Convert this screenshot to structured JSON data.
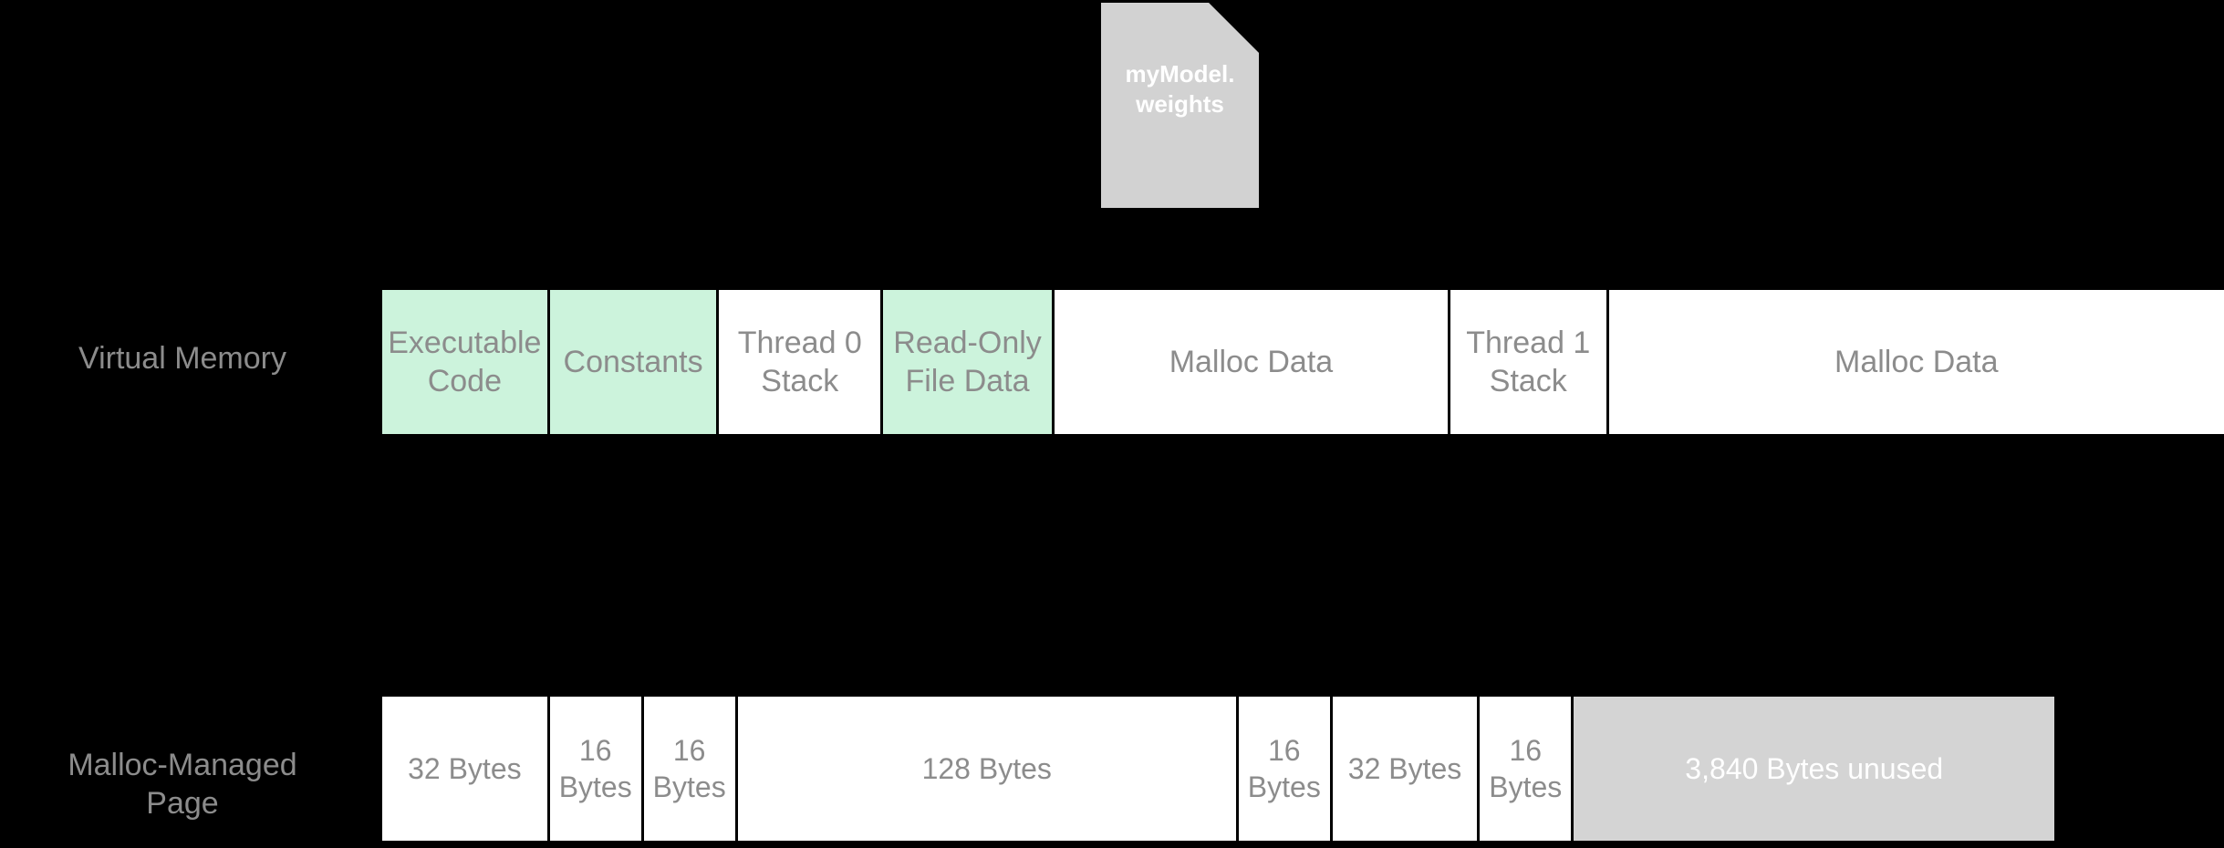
{
  "background_color": "#000000",
  "colors": {
    "text_gray": "#8c8c8c",
    "segment_white": "#ffffff",
    "segment_green": "#ccf3dc",
    "segment_gray": "#d4d4d4",
    "file_icon_gray": "#d2d2d2",
    "file_label_white": "#ffffff",
    "divider_black": "#000000"
  },
  "file_icon": {
    "icon_name": "document-file-icon",
    "label_line_1": "myModel.",
    "label_line_2": "weights"
  },
  "rows": [
    {
      "id": "virtual-memory",
      "label": "Virtual Memory",
      "segments": [
        {
          "name": "executable-code",
          "lines": [
            "Executable",
            "Code"
          ],
          "style": "green",
          "width_pct": 9.1
        },
        {
          "name": "constants",
          "lines": [
            "Constants"
          ],
          "style": "green",
          "width_pct": 9.2
        },
        {
          "name": "thread-0-stack",
          "lines": [
            "Thread 0",
            "Stack"
          ],
          "style": "white",
          "width_pct": 8.9
        },
        {
          "name": "read-only-file-data",
          "lines": [
            "Read-Only",
            "File Data"
          ],
          "style": "green",
          "width_pct": 9.3
        },
        {
          "name": "malloc-data-1",
          "lines": [
            "Malloc Data"
          ],
          "style": "white",
          "width_pct": 21.5
        },
        {
          "name": "thread-1-stack",
          "lines": [
            "Thread 1",
            "Stack"
          ],
          "style": "white",
          "width_pct": 8.6
        },
        {
          "name": "malloc-data-2",
          "lines": [
            "Malloc Data"
          ],
          "style": "white",
          "width_pct": 33.4
        }
      ]
    },
    {
      "id": "malloc-page",
      "label_line_1": "Malloc-Managed",
      "label_line_2": "Page",
      "label": "Malloc-Managed Page",
      "segments": [
        {
          "name": "block-32-bytes-a",
          "lines": [
            "32 Bytes"
          ],
          "style": "white",
          "width_pct": 9.1
        },
        {
          "name": "block-16-bytes-a",
          "lines": [
            "16",
            "Bytes"
          ],
          "style": "white",
          "width_pct": 5.1
        },
        {
          "name": "block-16-bytes-b",
          "lines": [
            "16",
            "Bytes"
          ],
          "style": "white",
          "width_pct": 5.1
        },
        {
          "name": "block-128-bytes",
          "lines": [
            "128 Bytes"
          ],
          "style": "white",
          "width_pct": 27.2
        },
        {
          "name": "block-16-bytes-c",
          "lines": [
            "16",
            "Bytes"
          ],
          "style": "white",
          "width_pct": 5.1
        },
        {
          "name": "block-32-bytes-b",
          "lines": [
            "32 Bytes"
          ],
          "style": "white",
          "width_pct": 8.0
        },
        {
          "name": "block-16-bytes-d",
          "lines": [
            "16",
            "Bytes"
          ],
          "style": "white",
          "width_pct": 5.1
        },
        {
          "name": "block-unused",
          "lines": [
            "3,840 Bytes unused"
          ],
          "style": "gray",
          "width_pct": 26.1
        }
      ]
    }
  ]
}
